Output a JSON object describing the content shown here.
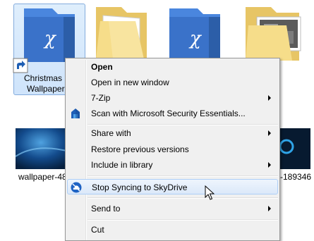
{
  "desktop": {
    "item1_label_line1": "Christmas",
    "item1_label_line2": "Wallpapers",
    "item5_label": "wallpaper-48",
    "item6_label": "-189346"
  },
  "context_menu": {
    "items": [
      {
        "label": "Open",
        "bold": true
      },
      {
        "label": "Open in new window"
      },
      {
        "label": "7-Zip",
        "submenu": true
      },
      {
        "label": "Scan with Microsoft Security Essentials...",
        "icon": "security-essentials-icon"
      },
      {
        "label": "Share with",
        "submenu": true
      },
      {
        "label": "Restore previous versions"
      },
      {
        "label": "Include in library",
        "submenu": true
      },
      {
        "label": "Stop Syncing to SkyDrive",
        "icon": "skydrive-icon",
        "highlighted": true
      },
      {
        "label": "Send to",
        "submenu": true
      },
      {
        "label": "Cut"
      }
    ]
  },
  "colors": {
    "menu_bg": "#f0f0f0",
    "highlight_bg": "#dbe8f9",
    "folder_blue": "#2f6fd6",
    "folder_yellow": "#f3d77c"
  }
}
